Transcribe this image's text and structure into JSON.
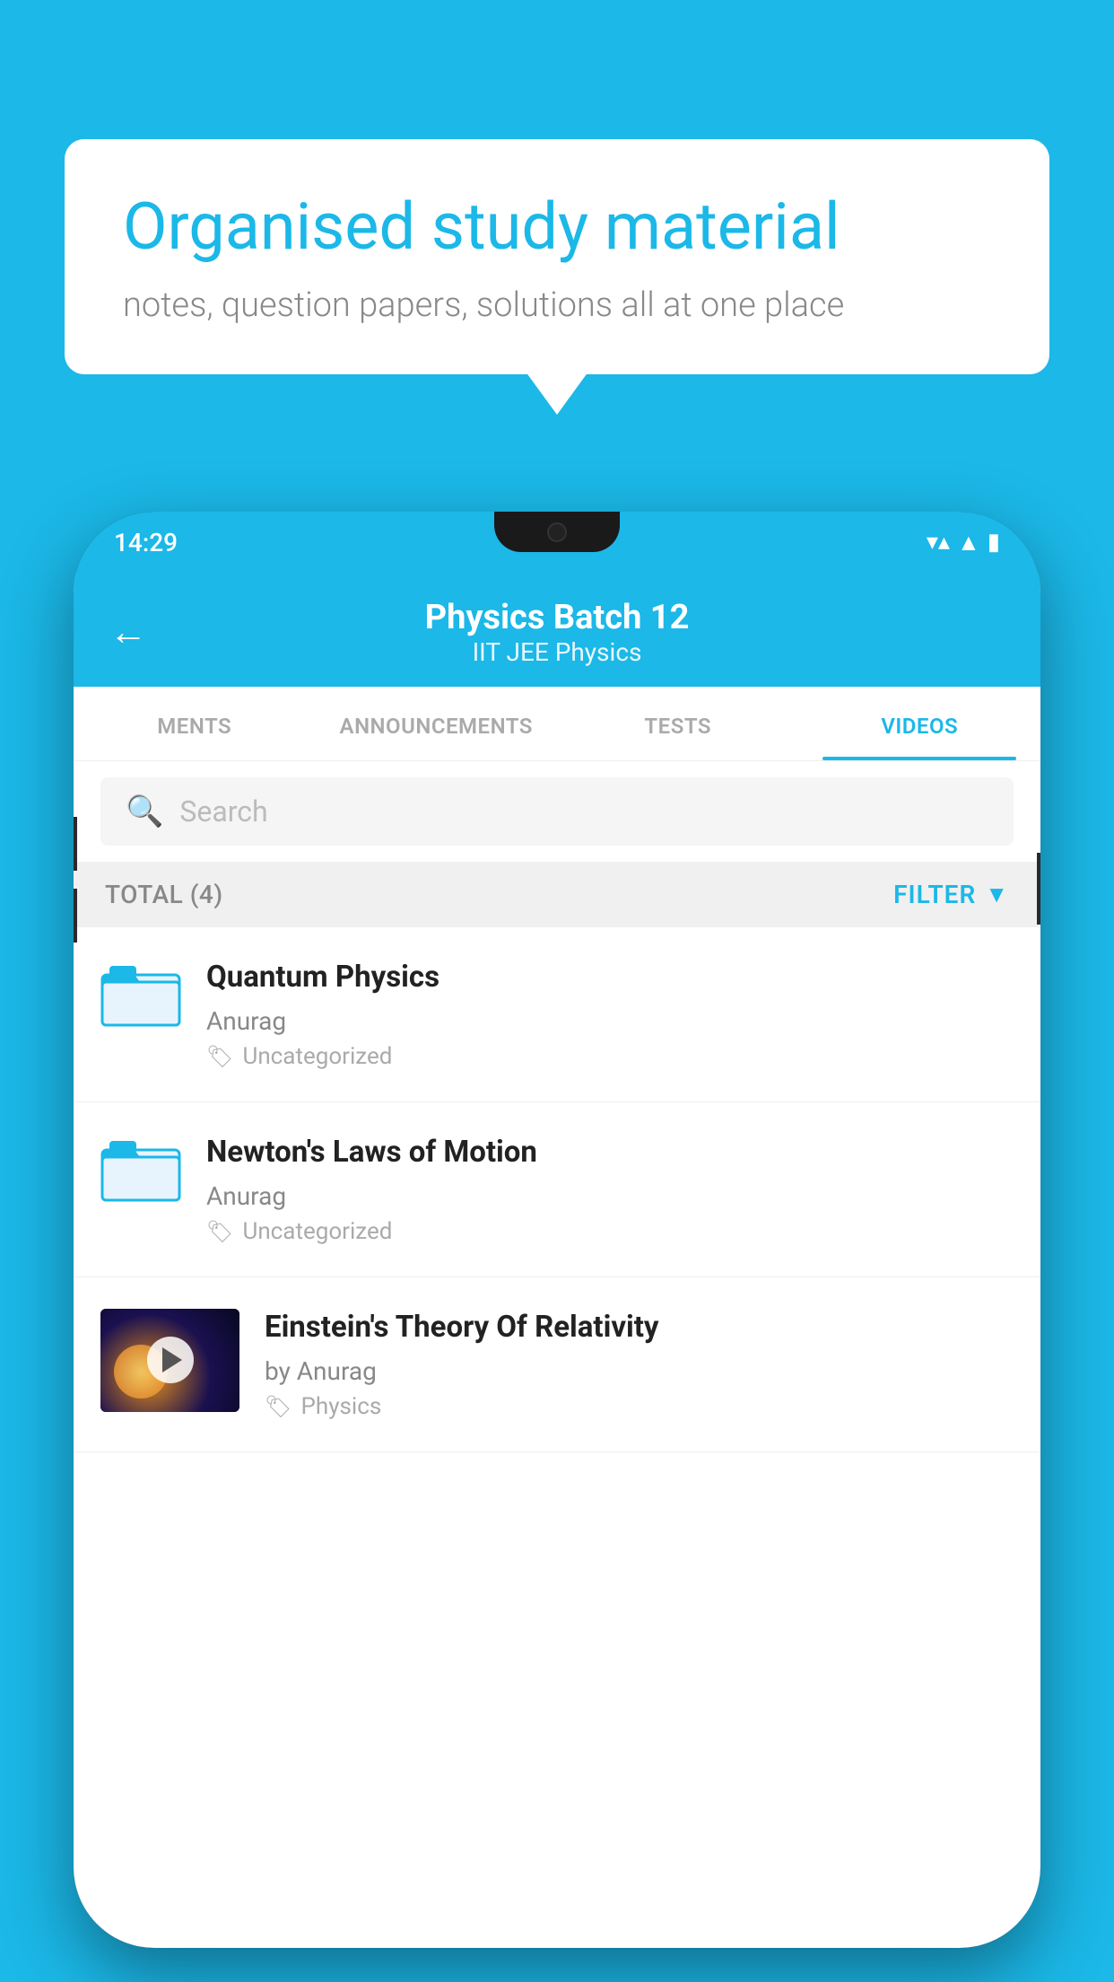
{
  "background": {
    "color": "#1bb8e8"
  },
  "speech_bubble": {
    "title": "Organised study material",
    "subtitle": "notes, question papers, solutions all at one place"
  },
  "phone": {
    "status_bar": {
      "time": "14:29",
      "wifi": "▼▲",
      "signal": "▲",
      "battery": "▮"
    },
    "header": {
      "back_label": "←",
      "title": "Physics Batch 12",
      "subtitle": "IIT JEE   Physics"
    },
    "tabs": [
      {
        "label": "MENTS",
        "active": false
      },
      {
        "label": "ANNOUNCEMENTS",
        "active": false
      },
      {
        "label": "TESTS",
        "active": false
      },
      {
        "label": "VIDEOS",
        "active": true
      }
    ],
    "search": {
      "placeholder": "Search"
    },
    "filter_bar": {
      "total_label": "TOTAL (4)",
      "filter_label": "FILTER"
    },
    "videos": [
      {
        "title": "Quantum Physics",
        "author": "Anurag",
        "tag": "Uncategorized",
        "type": "folder"
      },
      {
        "title": "Newton's Laws of Motion",
        "author": "Anurag",
        "tag": "Uncategorized",
        "type": "folder"
      },
      {
        "title": "Einstein's Theory Of Relativity",
        "author": "Anurag",
        "tag": "Physics",
        "type": "video",
        "by_prefix": "by"
      }
    ]
  }
}
